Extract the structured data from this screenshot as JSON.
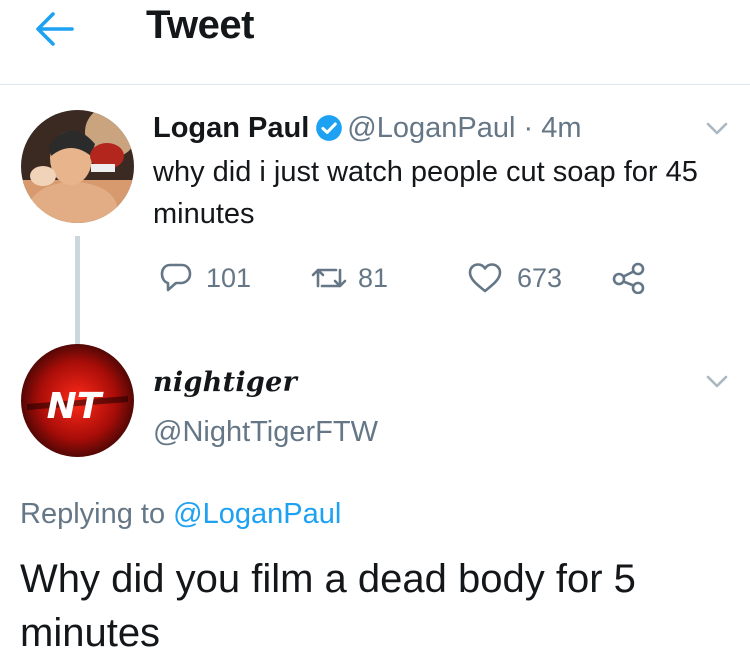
{
  "header": {
    "title": "Tweet"
  },
  "tweet": {
    "display_name": "Logan Paul",
    "handle": "@LoganPaul",
    "separator": "·",
    "time": "4m",
    "text": "why did i just watch people cut soap for 45 minutes",
    "actions": {
      "replies": "101",
      "retweets": "81",
      "likes": "673"
    }
  },
  "reply": {
    "display_name": "nightiger",
    "handle": "@NightTigerFTW",
    "avatar_text": "NT",
    "replying_prefix": "Replying to",
    "replying_to": "@LoganPaul",
    "text": "Why did you film a dead body for 5 minutes"
  },
  "colors": {
    "accent": "#1da1f2",
    "muted": "#657786",
    "text": "#14171a",
    "divider": "#e1e8ed"
  }
}
